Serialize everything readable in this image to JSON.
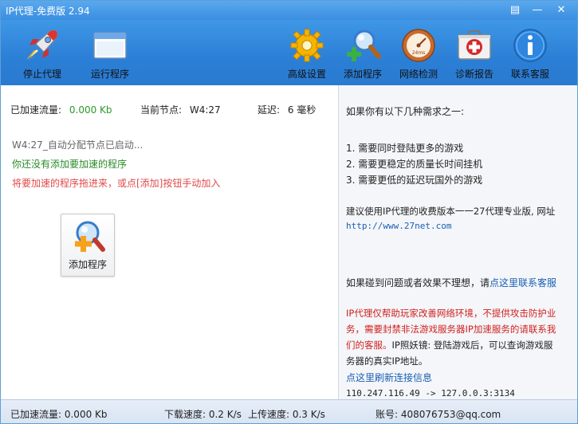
{
  "window": {
    "title": "IP代理-免费版 2.94",
    "buttons": {
      "menu": "▤",
      "minimize": "—",
      "close": "✕"
    }
  },
  "toolbar": {
    "stop_proxy": "停止代理",
    "running_programs": "运行程序",
    "advanced_settings": "高级设置",
    "add_program": "添加程序",
    "network_check": "网络检测",
    "diagnostic_report": "诊断报告",
    "contact_support": "联系客服"
  },
  "stats": {
    "accelerated_label": "已加速流量:",
    "accelerated_value": "0.000 Kb",
    "current_node_label": "当前节点:",
    "current_node_value": "W4:27",
    "latency_label": "延迟:",
    "latency_value": "6 毫秒"
  },
  "log": {
    "line1": "W4:27_自动分配节点已启动...",
    "line2": "你还没有添加要加速的程序",
    "line3": "将要加速的程序拖进来，或点[添加]按钮手动加入"
  },
  "add_program_box": {
    "label": "添加程序"
  },
  "right": {
    "intro": "如果你有以下几种需求之一:",
    "items": [
      "1. 需要同时登陆更多的游戏",
      "2. 需要更稳定的质量长时间挂机",
      "3. 需要更低的延迟玩国外的游戏"
    ],
    "suggest": "建议使用IP代理的收费版本一一27代理专业版, 网址",
    "url": "http://www.27net.com",
    "problem_text": "如果碰到问题或者效果不理想，请",
    "problem_link": "点这里联系客服",
    "warn_line1": "IP代理仅帮助玩家改善网络环境，不提供攻击防护业",
    "warn_line2": "务，需要封禁非法游戏服务器IP加速服务的请联系我",
    "warn_line3_red": "们的客服。",
    "warn_line3_rest": "IP照妖镜: 登陆游戏后，可以查询游戏服",
    "warn_line4": "务器的真实IP地址。",
    "refresh_link": "点这里刷新连接信息",
    "connection": "110.247.116.49 -> 127.0.0.3:3134"
  },
  "statusbar": {
    "accelerated": "已加速流量: 0.000 Kb",
    "download": "下载速度: 0.2 K/s",
    "upload": "上传速度: 0.3 K/s",
    "account": "账号: 408076753@qq.com"
  },
  "colors": {
    "accent_blue": "#3a8ee0",
    "green_text": "#2a9a2a",
    "red_text": "#d02020",
    "pink_text": "#e04a4a",
    "link_blue": "#1a5fb4"
  }
}
